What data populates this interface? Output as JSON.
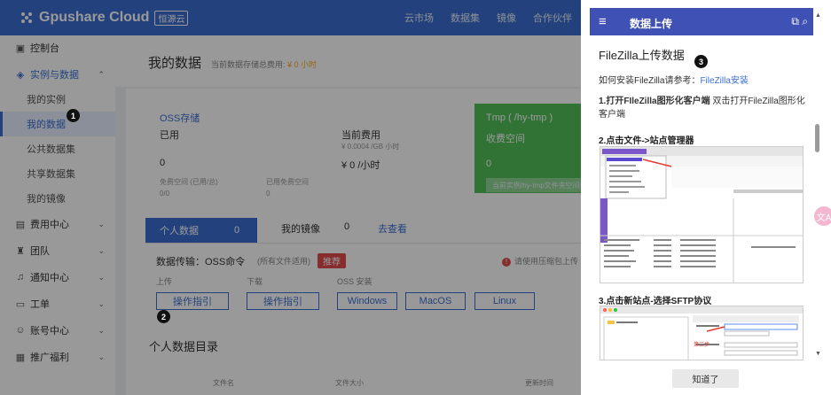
{
  "app": {
    "logo_text": "Gpushare Cloud",
    "logo_badge": "恒源云",
    "brand_color": "#3b6fd1"
  },
  "topnav": [
    "云市场",
    "数据集",
    "镜像",
    "合作伙伴",
    "解决"
  ],
  "sidebar": {
    "items": [
      {
        "label": "控制台",
        "icon": "dashboard-icon"
      },
      {
        "label": "实例与数据",
        "icon": "cube-icon"
      },
      {
        "label": "我的实例"
      },
      {
        "label": "我的数据"
      },
      {
        "label": "公共数据集"
      },
      {
        "label": "共享数据集"
      },
      {
        "label": "我的镜像"
      },
      {
        "label": "费用中心",
        "icon": "wallet-icon"
      },
      {
        "label": "团队",
        "icon": "team-icon"
      },
      {
        "label": "通知中心",
        "icon": "bell-icon"
      },
      {
        "label": "工单",
        "icon": "ticket-icon"
      },
      {
        "label": "账号中心",
        "icon": "user-icon"
      },
      {
        "label": "推广福利",
        "icon": "gift-icon"
      }
    ]
  },
  "main": {
    "title": "我的数据",
    "fee_label": "当前数据存储总费用:",
    "fee_value": "¥ 0 小时",
    "oss": {
      "title": "OSS存储",
      "used_label": "已用",
      "used_value": "0",
      "free_label": "免费空间 (已用/总)",
      "free_value": "0/0",
      "cur_fee_label": "当前费用",
      "cur_fee_rate": "¥ 0.0004 /GB 小时",
      "cur_fee_value": "¥ 0 /小时",
      "used_free_label": "已用免费空间",
      "used_free_value": "0"
    },
    "tmp": {
      "title": "Tmp ( /hy-tmp )",
      "label": "收费空间",
      "value": "0",
      "bar_text": "当前实例/hy-tmp文件夹空间已用"
    },
    "tabs": {
      "active_label": "个人数据",
      "active_count": "0",
      "tab2_label": "我的镜像",
      "tab2_count": "0",
      "tab2_link": "去查看"
    },
    "transfer": {
      "label": "数据传输：OSS命令",
      "note": "(所有文件适用)",
      "tag": "推荐",
      "warn": "请使用压缩包上传",
      "upload_label": "上传",
      "download_label": "下载",
      "install_label": "OSS 安装",
      "btn_upload": "操作指引",
      "btn_download": "操作指引",
      "btn_windows": "Windows",
      "btn_macos": "MacOS",
      "btn_linux": "Linux"
    },
    "dir": {
      "title": "个人数据目录",
      "col_name": "文件名",
      "col_size": "文件大小",
      "col_time": "更新时间"
    }
  },
  "panel": {
    "header": "数据上传",
    "title": "FileZilla上传数据",
    "install_text": "如何安装FileZilla请参考：",
    "install_link": "FileZilla安装",
    "step1_bold": "1.打开FIleZilla图形化客户端",
    "step1_rest": " 双击打开FileZilla图形化客户端",
    "step2": "2.点击文件->站点管理器",
    "step3": "3.点击新站点-选择SFTP协议",
    "shot2_label": "第二步",
    "footer_button": "知道了",
    "header_color": "#3f51b5"
  },
  "badges": {
    "b1": "1",
    "b2": "2",
    "b3": "3"
  },
  "float_tool": "文A"
}
